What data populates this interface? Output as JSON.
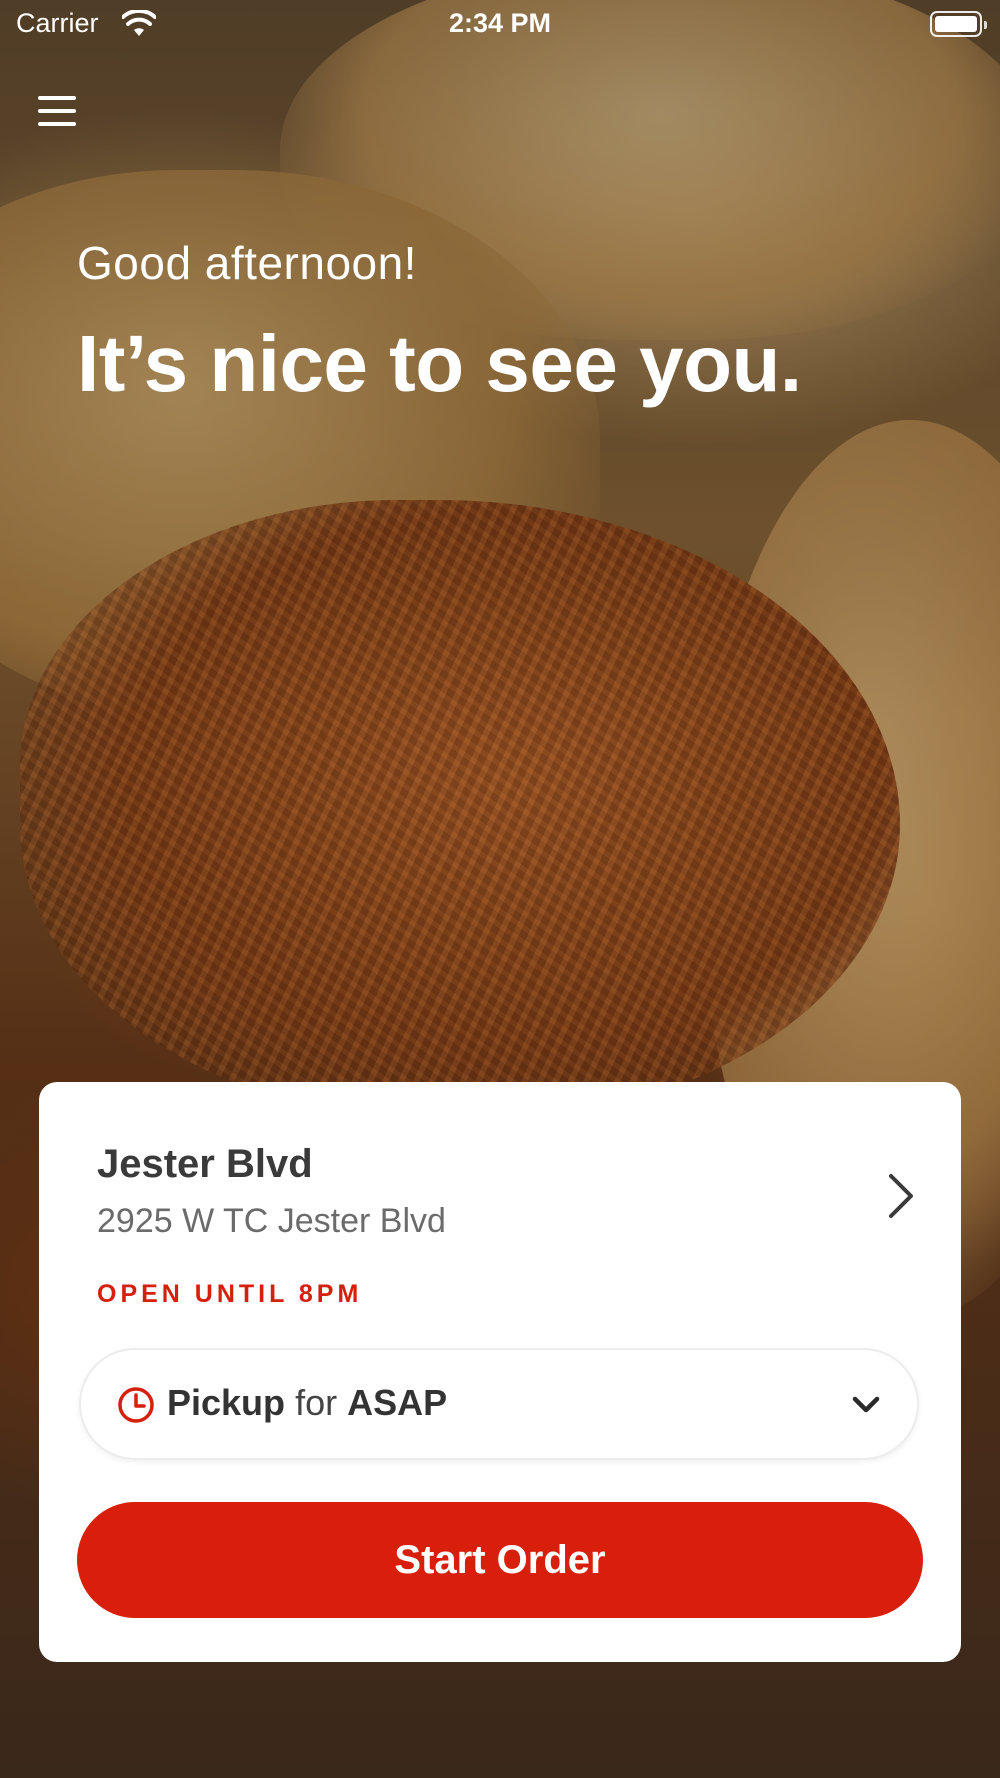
{
  "status_bar": {
    "carrier": "Carrier",
    "time": "2:34 PM"
  },
  "menu": {
    "icon": "hamburger-menu-icon"
  },
  "hero": {
    "greeting": "Good afternoon!",
    "headline": "It’s nice to see you."
  },
  "location": {
    "name": "Jester Blvd",
    "address": "2925 W TC Jester Blvd",
    "status": "OPEN UNTIL 8PM",
    "status_color": "#d4200c"
  },
  "order_mode": {
    "mode": "Pickup",
    "connector": "for",
    "time": "ASAP",
    "icon": "clock-icon"
  },
  "cta": {
    "label": "Start Order",
    "color": "#d81f0b"
  }
}
